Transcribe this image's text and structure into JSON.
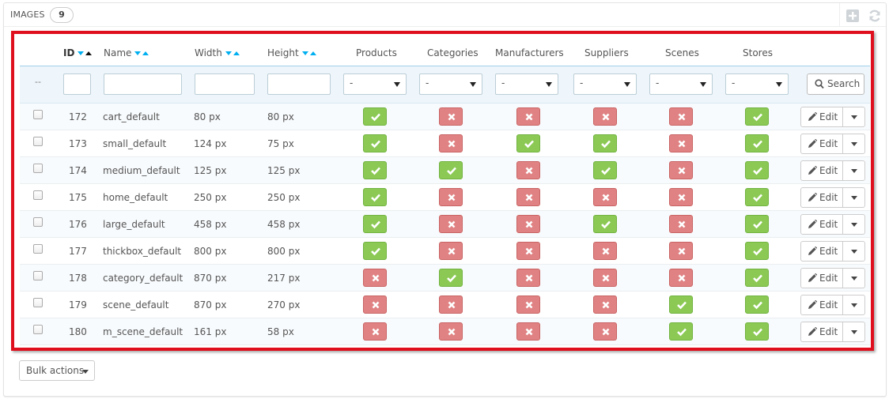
{
  "panel": {
    "title": "IMAGES",
    "count": "9"
  },
  "toolbar": {
    "add_icon": "add-new-icon",
    "refresh_icon": "refresh-icon"
  },
  "colors": {
    "highlight": "#e00f1e",
    "enabled": "#8bc954",
    "disabled": "#e08283",
    "filter_bg": "#eef6fb"
  },
  "columns": {
    "id": "ID",
    "name": "Name",
    "width": "Width",
    "height": "Height",
    "products": "Products",
    "categories": "Categories",
    "manufacturers": "Manufacturers",
    "suppliers": "Suppliers",
    "scenes": "Scenes",
    "stores": "Stores"
  },
  "filters": {
    "dash": "--",
    "select_value": "-",
    "search_label": "Search"
  },
  "rows": [
    {
      "id": "172",
      "name": "cart_default",
      "width": "80 px",
      "height": "80 px",
      "flags": [
        true,
        false,
        false,
        false,
        false,
        true
      ]
    },
    {
      "id": "173",
      "name": "small_default",
      "width": "124 px",
      "height": "75 px",
      "flags": [
        true,
        false,
        true,
        true,
        false,
        true
      ]
    },
    {
      "id": "174",
      "name": "medium_default",
      "width": "125 px",
      "height": "125 px",
      "flags": [
        true,
        true,
        false,
        true,
        false,
        true
      ]
    },
    {
      "id": "175",
      "name": "home_default",
      "width": "250 px",
      "height": "250 px",
      "flags": [
        true,
        false,
        false,
        false,
        false,
        true
      ]
    },
    {
      "id": "176",
      "name": "large_default",
      "width": "458 px",
      "height": "458 px",
      "flags": [
        true,
        false,
        false,
        true,
        false,
        true
      ]
    },
    {
      "id": "177",
      "name": "thickbox_default",
      "width": "800 px",
      "height": "800 px",
      "flags": [
        true,
        false,
        false,
        false,
        false,
        true
      ]
    },
    {
      "id": "178",
      "name": "category_default",
      "width": "870 px",
      "height": "217 px",
      "flags": [
        false,
        true,
        false,
        false,
        false,
        true
      ]
    },
    {
      "id": "179",
      "name": "scene_default",
      "width": "870 px",
      "height": "270 px",
      "flags": [
        false,
        false,
        false,
        false,
        true,
        true
      ]
    },
    {
      "id": "180",
      "name": "m_scene_default",
      "width": "161 px",
      "height": "58 px",
      "flags": [
        false,
        false,
        false,
        false,
        true,
        true
      ]
    }
  ],
  "row_actions": {
    "edit_label": "Edit"
  },
  "footer": {
    "bulk_label": "Bulk actions"
  }
}
